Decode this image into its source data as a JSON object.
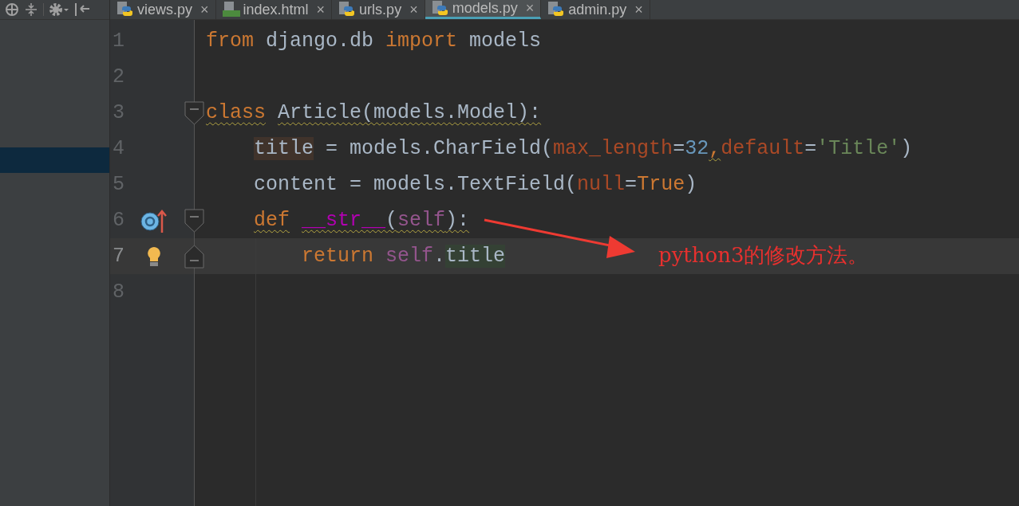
{
  "project_panel": {
    "rows": [
      {
        "selected": false
      },
      {
        "selected": false
      },
      {
        "selected": false
      },
      {
        "selected": false
      },
      {
        "selected": false
      },
      {
        "selected": true
      }
    ]
  },
  "tabs": [
    {
      "label": "views.py",
      "kind": "python",
      "selected": false
    },
    {
      "label": "index.html",
      "kind": "html",
      "selected": false
    },
    {
      "label": "urls.py",
      "kind": "python",
      "selected": false
    },
    {
      "label": "models.py",
      "kind": "python",
      "selected": true
    },
    {
      "label": "admin.py",
      "kind": "python",
      "selected": false
    }
  ],
  "close_glyph": "×",
  "editor": {
    "lines": [
      {
        "number": "1",
        "current": false,
        "tokens": [
          {
            "text": "from",
            "kind": "keyword",
            "warning": false
          },
          {
            "text": " django.db ",
            "kind": "plain",
            "warning": false
          },
          {
            "text": "import",
            "kind": "keyword",
            "warning": false
          },
          {
            "text": " models",
            "kind": "plain",
            "warning": false
          }
        ]
      },
      {
        "number": "2",
        "current": false
      },
      {
        "number": "3",
        "current": false,
        "gutter_icons": [
          {
            "kind": "fold_start"
          }
        ],
        "tokens": [
          {
            "text": "class",
            "kind": "keyword",
            "warning": true
          },
          {
            "text": " Article(models.Model):",
            "kind": "plain",
            "warning": true
          }
        ]
      },
      {
        "number": "4",
        "current": false,
        "tokens": [
          {
            "text": "    title",
            "kind": "write_ref",
            "warning": false
          },
          {
            "text": " = models.CharField(",
            "kind": "plain",
            "warning": false
          },
          {
            "text": "max_length",
            "kind": "param",
            "warning": false
          },
          {
            "text": "=",
            "kind": "plain",
            "warning": false
          },
          {
            "text": "32",
            "kind": "number",
            "warning": false
          },
          {
            "text": ",",
            "kind": "keyword",
            "warning": true
          },
          {
            "text": "default",
            "kind": "param",
            "warning": false
          },
          {
            "text": "=",
            "kind": "plain",
            "warning": false
          },
          {
            "text": "'Title'",
            "kind": "string",
            "warning": false
          },
          {
            "text": ")",
            "kind": "plain",
            "warning": false
          }
        ]
      },
      {
        "number": "5",
        "current": false,
        "tokens": [
          {
            "text": "    content = models.TextField(",
            "kind": "plain",
            "warning": false
          },
          {
            "text": "null",
            "kind": "param",
            "warning": false
          },
          {
            "text": "=",
            "kind": "plain",
            "warning": false
          },
          {
            "text": "True",
            "kind": "keyword",
            "warning": false
          },
          {
            "text": ")",
            "kind": "plain",
            "warning": false
          }
        ]
      },
      {
        "number": "6",
        "current": false,
        "gutter_icons": [
          {
            "kind": "override"
          },
          {
            "kind": "fold_start"
          }
        ],
        "tokens": [
          {
            "text": "    def",
            "kind": "keyword",
            "warning": true
          },
          {
            "text": " __str__",
            "kind": "magic",
            "warning": true
          },
          {
            "text": "(",
            "kind": "plain",
            "warning": true
          },
          {
            "text": "self",
            "kind": "self",
            "warning": true
          },
          {
            "text": "):",
            "kind": "plain",
            "warning": true
          }
        ]
      },
      {
        "number": "7",
        "current": true,
        "gutter_icons": [
          {
            "kind": "bulb"
          },
          {
            "kind": "fold_end"
          }
        ],
        "tokens": [
          {
            "text": "        return",
            "kind": "keyword",
            "warning": false
          },
          {
            "text": " self",
            "kind": "self",
            "warning": false
          },
          {
            "text": ".",
            "kind": "plain",
            "warning": false
          },
          {
            "text": "title",
            "kind": "read_ref",
            "warning": false
          }
        ]
      },
      {
        "number": "8",
        "current": false
      }
    ]
  },
  "annotation": {
    "text": "python3的修改方法。"
  }
}
